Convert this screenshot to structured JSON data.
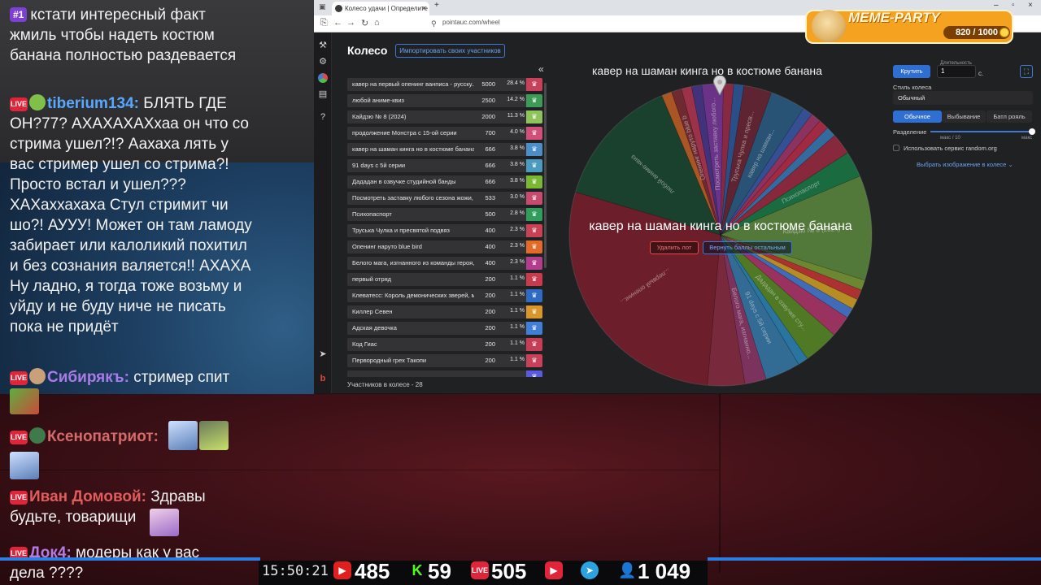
{
  "chat": {
    "messages": [
      {
        "badge": "#1",
        "text": "кстати интересный факт жмиль чтобы надеть костюм банана полностью раздевается"
      },
      {
        "nick": "tiberium134:",
        "nick_color": "#59a8ff",
        "text": " БЛЯТЬ ГДЕ ОН?77? АХАХАХАХхаа он что со стрима ушел?!? Аахаха лять у вас стример ушел со стрима?! Просто встал и ушел??? ХАХаххахаха Стул стримит чи шо?! АУУУ! Может он там ламоду забирает или калоликий похитил и без сознания валяется!! АХАХА Ну ладно, я тогда тоже возьму и уйду и не буду ниче не писать пока не придёт"
      },
      {
        "nick": "Сибирякъ:",
        "nick_color": "#a97be8",
        "text": " стример спит"
      },
      {
        "nick": "Ксенопатриот:",
        "nick_color": "#d46a6a",
        "text": ""
      },
      {
        "nick": "Иван Домовой:",
        "nick_color": "#e25c5c",
        "text": " Здравы будьте, товарищи"
      },
      {
        "nick": "Док4:",
        "nick_color": "#b57be0",
        "text": " модеры как у вас дела ????"
      }
    ],
    "live_label": "LIVE"
  },
  "bottom_bar": {
    "time": "15:50:21",
    "youtube_count": "485",
    "kick_count": "59",
    "vk_live_count": "505",
    "viewers_count": "1 049"
  },
  "browser": {
    "tab_title": "Колесо удачи | Определите ло",
    "url": "pointauc.com/wheel"
  },
  "app": {
    "title": "Колесо",
    "import_button": "Импортировать своих участников",
    "participants_count": "Участников в колесе - 28",
    "wheel_title": "кавер на шаман кинга но в костюме банана",
    "winner_text": "кавер на шаман кинга но в костюме банана",
    "delete_button": "Удалить лот",
    "return_button": "Вернуть баллы остальным",
    "spin_button": "Крутить",
    "duration_label": "Длительность",
    "duration_value": "1",
    "duration_unit": "с.",
    "wheel_style_label": "Стиль колеса",
    "wheel_style_value": "Обычный",
    "modes": [
      "Обычное",
      "Выбывание",
      "Батл рояль"
    ],
    "split_label": "Разделение",
    "split_min": "макс / 10",
    "split_max": "макс",
    "random_org_label": "Использовать сервис random.org",
    "choose_image": "Выбрать изображение в колесе"
  },
  "lots": [
    {
      "name": "кавер на первый опенинг ванписа - русску...",
      "amount": "5000",
      "pct": "28.4 %",
      "color": "#c8405a"
    },
    {
      "name": "любой аниме-квиз",
      "amount": "2500",
      "pct": "14.2 %",
      "color": "#3e9a57"
    },
    {
      "name": "Кайдзю № 8 (2024)",
      "amount": "2000",
      "pct": "11.3 %",
      "color": "#8fc35c"
    },
    {
      "name": "продолжение Монстра с 15-ой серии",
      "amount": "700",
      "pct": "4.0 %",
      "color": "#d24f7a"
    },
    {
      "name": "кавер на шаман кинга но в костюме банана",
      "amount": "666",
      "pct": "3.8 %",
      "color": "#4b8fc9"
    },
    {
      "name": "91 days с 5й серии",
      "amount": "666",
      "pct": "3.8 %",
      "color": "#4b9abf"
    },
    {
      "name": "Дададан в озвучке студийной банды",
      "amount": "666",
      "pct": "3.8 %",
      "color": "#7ab833"
    },
    {
      "name": "Посмотреть заставку любого сезона жожи, ...",
      "amount": "533",
      "pct": "3.0 %",
      "color": "#c84a6e"
    },
    {
      "name": "Психопаспорт",
      "amount": "500",
      "pct": "2.8 %",
      "color": "#2e9e5a"
    },
    {
      "name": "Труська Чулка и пресвятой подвяз",
      "amount": "400",
      "pct": "2.3 %",
      "color": "#c94155"
    },
    {
      "name": "Опенинг наруто blue bird",
      "amount": "400",
      "pct": "2.3 %",
      "color": "#e46a2a"
    },
    {
      "name": "Белого мага, изгнанного из команды героя, ...",
      "amount": "400",
      "pct": "2.3 %",
      "color": "#b43c8c"
    },
    {
      "name": "первый отряд",
      "amount": "200",
      "pct": "1.1 %",
      "color": "#c83b4c"
    },
    {
      "name": "Клеватесс: Король демонических зверей, м...",
      "amount": "200",
      "pct": "1.1 %",
      "color": "#2d6bc4"
    },
    {
      "name": "Киллер Севен",
      "amount": "200",
      "pct": "1.1 %",
      "color": "#d9962a"
    },
    {
      "name": "Адская девочка",
      "amount": "200",
      "pct": "1.1 %",
      "color": "#3f7fd8"
    },
    {
      "name": "Код Гиас",
      "amount": "200",
      "pct": "1.1 %",
      "color": "#c73d55"
    },
    {
      "name": "Первородный грех Такопи",
      "amount": "200",
      "pct": "1.1 %",
      "color": "#c8405a"
    },
    {
      "name": "",
      "amount": "",
      "pct": "",
      "color": "#5a5adc"
    }
  ],
  "wheel_slices": [
    {
      "pct": 28.4,
      "color": "#7b2330",
      "label": "...первый опенинг..."
    },
    {
      "pct": 14.2,
      "color": "#1e4a34",
      "label": "любой аниме-квиз"
    },
    {
      "pct": 1.1,
      "color": "#c2612a",
      "label": ""
    },
    {
      "pct": 1.1,
      "color": "#7e2f38",
      "label": "Опенинг наруто blue b"
    },
    {
      "pct": 1.1,
      "color": "#b23a55",
      "label": ""
    },
    {
      "pct": 1.1,
      "color": "#4a3a8a",
      "label": ""
    },
    {
      "pct": 2.3,
      "color": "#7a3b9a",
      "label": "Посмотреть заставку любого..."
    },
    {
      "pct": 1.1,
      "color": "#9c2f4a",
      "label": ""
    },
    {
      "pct": 1.1,
      "color": "#2e5a9a",
      "label": ""
    },
    {
      "pct": 3.0,
      "color": "#6d2a3a",
      "label": "Труська Чулка и пресв..."
    },
    {
      "pct": 3.8,
      "color": "#2f5f86",
      "label": "кавер на шаман..."
    },
    {
      "pct": 1.1,
      "color": "#3d5aa8",
      "label": ""
    },
    {
      "pct": 1.1,
      "color": "#a03a6a",
      "label": ""
    },
    {
      "pct": 1.1,
      "color": "#b5304a",
      "label": ""
    },
    {
      "pct": 1.1,
      "color": "#3b7ab5",
      "label": ""
    },
    {
      "pct": 2.3,
      "color": "#9a2e46",
      "label": ""
    },
    {
      "pct": 2.8,
      "color": "#1f7a4a",
      "label": "Психопаспорт"
    },
    {
      "pct": 11.3,
      "color": "#5e8a42",
      "label": "Кайдзю № 8 (2024)"
    },
    {
      "pct": 1.1,
      "color": "#7a9a3a",
      "label": ""
    },
    {
      "pct": 1.1,
      "color": "#c43a3a",
      "label": ""
    },
    {
      "pct": 1.1,
      "color": "#d0a02a",
      "label": ""
    },
    {
      "pct": 1.1,
      "color": "#4a7ad0",
      "label": ""
    },
    {
      "pct": 2.3,
      "color": "#b03a6e",
      "label": ""
    },
    {
      "pct": 3.8,
      "color": "#5a8a2a",
      "label": "Дададан в озвучке сту..."
    },
    {
      "pct": 1.1,
      "color": "#2f86b5",
      "label": ""
    },
    {
      "pct": 3.8,
      "color": "#3a7aa8",
      "label": "91 days с 5й серии"
    },
    {
      "pct": 2.3,
      "color": "#8c3a6a",
      "label": "Белого мага, изгнанно..."
    },
    {
      "pct": 4.0,
      "color": "#8a2f45",
      "label": ""
    }
  ],
  "overlay": {
    "title": "MEME-PARTY",
    "score": "820 / 1000"
  }
}
